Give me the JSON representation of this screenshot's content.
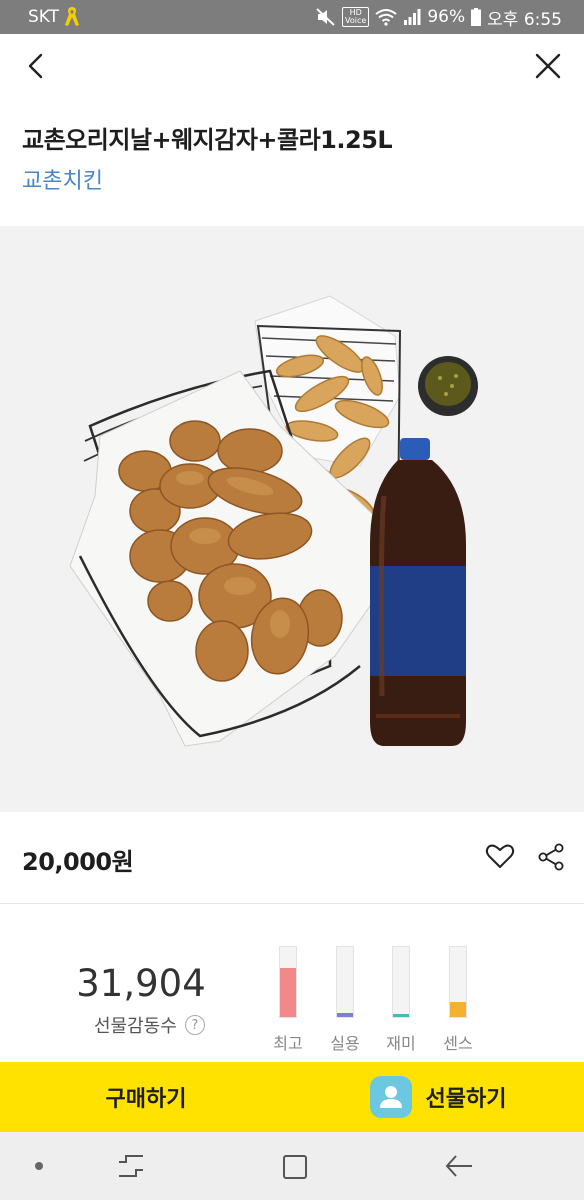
{
  "status_bar": {
    "carrier": "SKT",
    "battery": "96%",
    "time": "오후 6:55",
    "icons": [
      "ribbon-icon",
      "mute-icon",
      "hd-voice-icon",
      "wifi-icon",
      "signal-icon",
      "battery-icon"
    ]
  },
  "header": {
    "back_icon": "chevron-left-icon",
    "close_icon": "close-icon"
  },
  "product": {
    "title": "교촌오리지날+웨지감자+콜라1.25L",
    "brand": "교촌치킨",
    "price": "20,000원"
  },
  "gift_score": {
    "value": "31,904",
    "label": "선물감동수",
    "help": "?",
    "bars": [
      {
        "label": "최고",
        "level": 0.7,
        "color": "#f08a8a"
      },
      {
        "label": "실용",
        "level": 0.06,
        "color": "#7b7fd6"
      },
      {
        "label": "재미",
        "level": 0.04,
        "color": "#3dbfb7"
      },
      {
        "label": "센스",
        "level": 0.21,
        "color": "#f5b030"
      }
    ]
  },
  "actions": {
    "buy_label": "구매하기",
    "gift_label": "선물하기"
  },
  "colors": {
    "brand_link": "#4a86c8",
    "action_bar": "#ffe200",
    "gift_avatar": "#6cc7e0"
  }
}
